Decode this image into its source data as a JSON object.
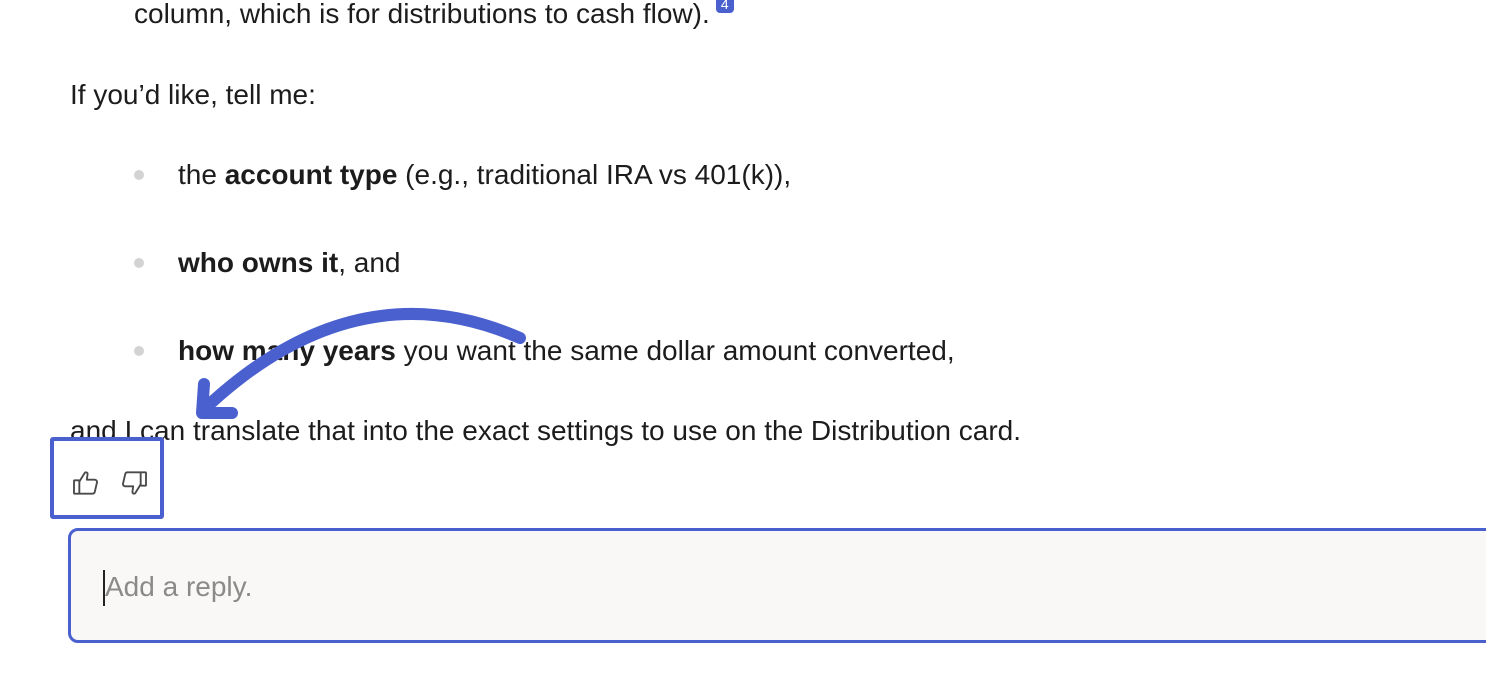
{
  "message": {
    "top_line": "column, which is for distributions to cash flow).",
    "citation_number": "4",
    "intro": "If you’d like, tell me:",
    "bullets": [
      {
        "pre": "the ",
        "bold": "account type",
        "post": " (e.g., traditional IRA vs 401(k)),"
      },
      {
        "pre": "",
        "bold": "who owns it",
        "post": ", and"
      },
      {
        "pre": "",
        "bold": "how many years",
        "post": " you want the same dollar amount converted,"
      }
    ],
    "closing": "and I can translate that into the exact settings to use on the Distribution card."
  },
  "feedback": {
    "thumbs_up_icon": "thumbs-up-icon",
    "thumbs_down_icon": "thumbs-down-icon"
  },
  "reply": {
    "placeholder": "Add a reply.",
    "value": ""
  },
  "annotation": {
    "color": "#4a60cf"
  }
}
